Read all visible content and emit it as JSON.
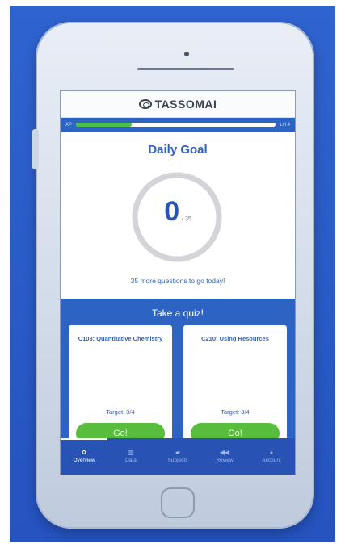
{
  "app": {
    "logo_text": "TASSOMAI"
  },
  "xp": {
    "label": "XP",
    "level_label": "Lvl 4",
    "progress": 0.28
  },
  "daily_goal": {
    "title": "Daily Goal",
    "count": "0",
    "total": "/ 35",
    "message": "35 more questions to go today!",
    "progress": 0
  },
  "quiz": {
    "title": "Take a quiz!",
    "cards": [
      {
        "name": "C103: Quantitative Chemistry",
        "target": "Target: 3/4",
        "button": "Go!"
      },
      {
        "name": "C210: Using Resources",
        "target": "Target: 3/4",
        "button": "Go!"
      }
    ]
  },
  "tabs": [
    {
      "label": "Overview",
      "icon": "gear-icon",
      "glyph": "✿"
    },
    {
      "label": "Data",
      "icon": "chart-icon",
      "glyph": "▥"
    },
    {
      "label": "Subjects",
      "icon": "book-icon",
      "glyph": "▰"
    },
    {
      "label": "Review",
      "icon": "rewind-icon",
      "glyph": "◀◀"
    },
    {
      "label": "Account",
      "icon": "person-icon",
      "glyph": "▲"
    }
  ],
  "colors": {
    "brand_blue": "#2d64c4",
    "accent_green": "#58bd3c",
    "background_blue": "#2553c0"
  }
}
